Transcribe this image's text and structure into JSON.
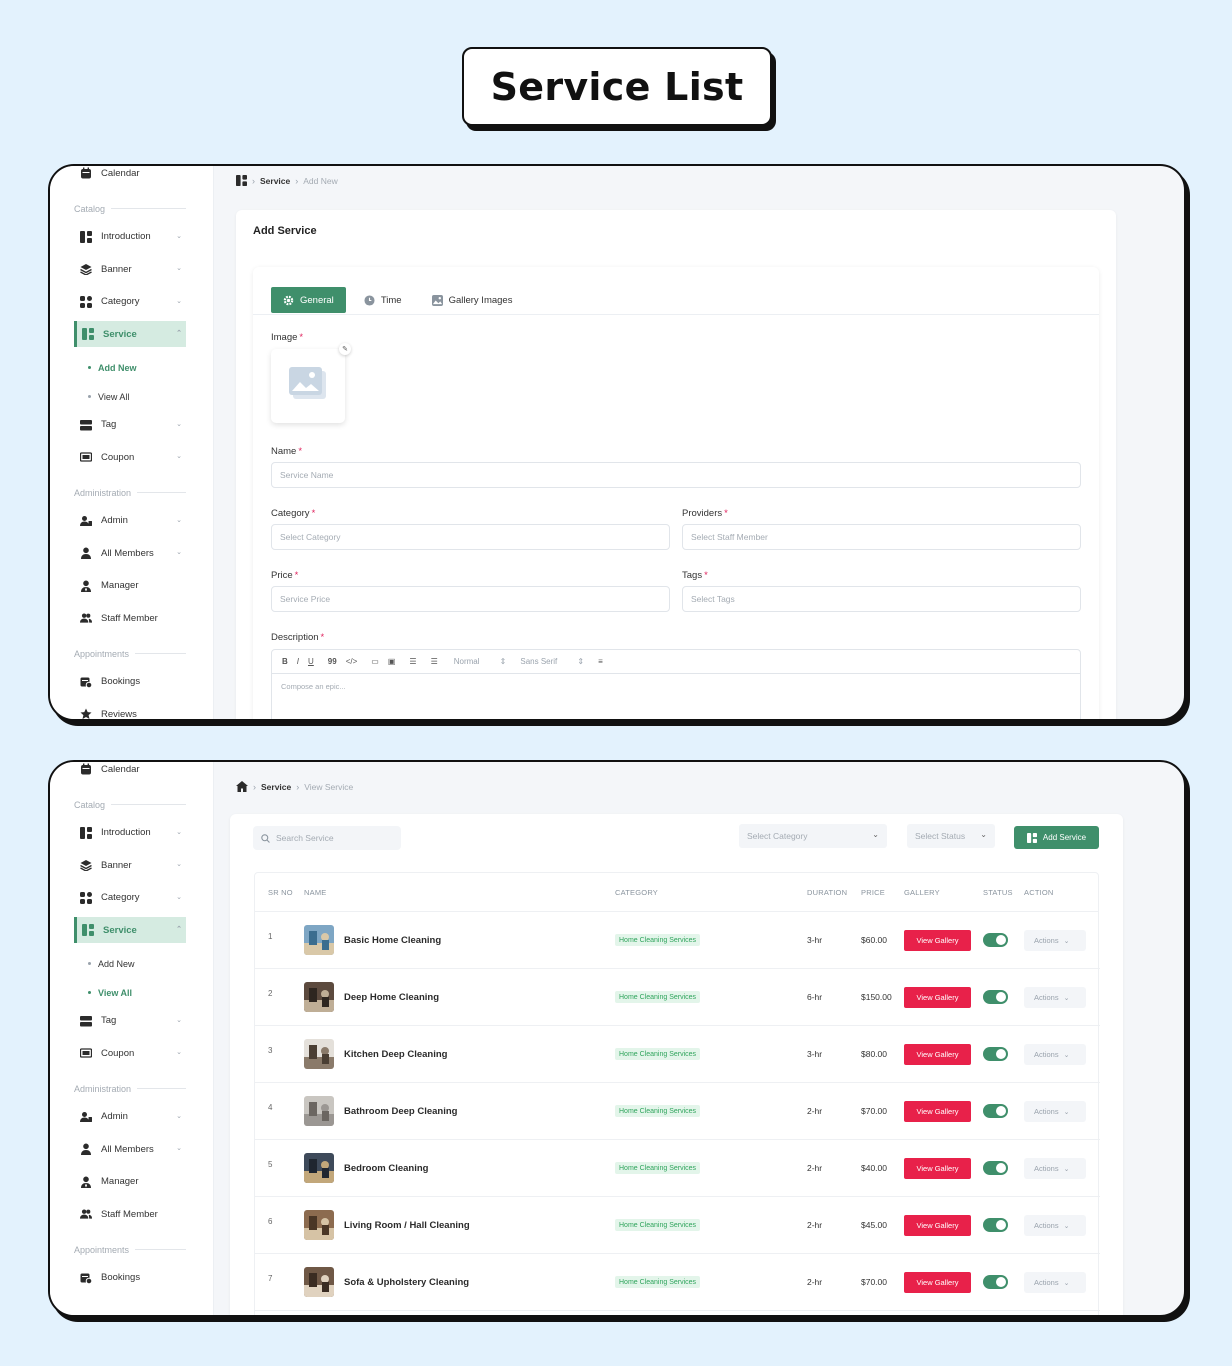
{
  "page_title": "Service List",
  "colors": {
    "accent": "#3f8f6b",
    "danger": "#e8214a",
    "background": "#e3f2fd"
  },
  "sidebar1": {
    "items": [
      {
        "label": "Calendar",
        "icon": "calendar-icon"
      },
      {
        "section": "Catalog"
      },
      {
        "label": "Introduction",
        "icon": "layout-icon",
        "chevron": true
      },
      {
        "label": "Banner",
        "icon": "layers-icon",
        "chevron": true
      },
      {
        "label": "Category",
        "icon": "grid-icon",
        "chevron": true
      },
      {
        "label": "Service",
        "icon": "layout-icon",
        "chevron": true,
        "active": true
      },
      {
        "sub": "Add New",
        "active": true
      },
      {
        "sub": "View All"
      },
      {
        "label": "Tag",
        "icon": "tag-icon",
        "chevron": true
      },
      {
        "label": "Coupon",
        "icon": "coupon-icon",
        "chevron": true
      },
      {
        "section": "Administration"
      },
      {
        "label": "Admin",
        "icon": "admin-icon",
        "chevron": true
      },
      {
        "label": "All Members",
        "icon": "user-icon",
        "chevron": true
      },
      {
        "label": "Manager",
        "icon": "manager-icon"
      },
      {
        "label": "Staff Member",
        "icon": "users-icon"
      },
      {
        "section": "Appointments"
      },
      {
        "label": "Bookings",
        "icon": "bookings-icon"
      },
      {
        "label": "Reviews",
        "icon": "star-icon"
      }
    ]
  },
  "sidebar2": {
    "items": [
      {
        "label": "Calendar",
        "icon": "calendar-icon"
      },
      {
        "section": "Catalog"
      },
      {
        "label": "Introduction",
        "icon": "layout-icon",
        "chevron": true
      },
      {
        "label": "Banner",
        "icon": "layers-icon",
        "chevron": true
      },
      {
        "label": "Category",
        "icon": "grid-icon",
        "chevron": true
      },
      {
        "label": "Service",
        "icon": "layout-icon",
        "chevron": true,
        "active": true
      },
      {
        "sub": "Add New"
      },
      {
        "sub": "View All",
        "active": true
      },
      {
        "label": "Tag",
        "icon": "tag-icon",
        "chevron": true
      },
      {
        "label": "Coupon",
        "icon": "coupon-icon",
        "chevron": true
      },
      {
        "section": "Administration"
      },
      {
        "label": "Admin",
        "icon": "admin-icon",
        "chevron": true
      },
      {
        "label": "All Members",
        "icon": "user-icon",
        "chevron": true
      },
      {
        "label": "Manager",
        "icon": "manager-icon"
      },
      {
        "label": "Staff Member",
        "icon": "users-icon"
      },
      {
        "section": "Appointments"
      },
      {
        "label": "Bookings",
        "icon": "bookings-icon"
      }
    ]
  },
  "add": {
    "breadcrumb": {
      "parent": "Service",
      "current": "Add New"
    },
    "card_title": "Add Service",
    "tabs": [
      "General",
      "Time",
      "Gallery Images"
    ],
    "image_label": "Image",
    "name_label": "Name",
    "name_placeholder": "Service Name",
    "category_label": "Category",
    "category_placeholder": "Select Category",
    "providers_label": "Providers",
    "providers_placeholder": "Select Staff Member",
    "price_label": "Price",
    "price_placeholder": "Service Price",
    "tags_label": "Tags",
    "tags_placeholder": "Select Tags",
    "description_label": "Description",
    "toolbar": {
      "bold": "B",
      "italic": "I",
      "underline": "U",
      "quote": "99",
      "code": "</>",
      "size": "Normal",
      "font": "Sans Serif"
    },
    "editor_placeholder": "Compose an epic..."
  },
  "list": {
    "breadcrumb": {
      "parent": "Service",
      "current": "View Service"
    },
    "search_placeholder": "Search Service",
    "category_filter": "Select Category",
    "status_filter": "Select Status",
    "add_button": "Add Service",
    "columns": [
      "SR NO",
      "NAME",
      "CATEGORY",
      "DURATION",
      "PRICE",
      "GALLERY",
      "STATUS",
      "ACTION"
    ],
    "gallery_button": "View Gallery",
    "actions_label": "Actions",
    "rows": [
      {
        "sr": "1",
        "name": "Basic Home Cleaning",
        "category": "Home Cleaning Services",
        "duration": "3-hr",
        "price": "$60.00",
        "status": true
      },
      {
        "sr": "2",
        "name": "Deep Home Cleaning",
        "category": "Home Cleaning Services",
        "duration": "6-hr",
        "price": "$150.00",
        "status": true
      },
      {
        "sr": "3",
        "name": "Kitchen Deep Cleaning",
        "category": "Home Cleaning Services",
        "duration": "3-hr",
        "price": "$80.00",
        "status": true
      },
      {
        "sr": "4",
        "name": "Bathroom Deep Cleaning",
        "category": "Home Cleaning Services",
        "duration": "2-hr",
        "price": "$70.00",
        "status": true
      },
      {
        "sr": "5",
        "name": "Bedroom Cleaning",
        "category": "Home Cleaning Services",
        "duration": "2-hr",
        "price": "$40.00",
        "status": true
      },
      {
        "sr": "6",
        "name": "Living Room / Hall Cleaning",
        "category": "Home Cleaning Services",
        "duration": "2-hr",
        "price": "$45.00",
        "status": true
      },
      {
        "sr": "7",
        "name": "Sofa & Upholstery Cleaning",
        "category": "Home Cleaning Services",
        "duration": "2-hr",
        "price": "$70.00",
        "status": true
      }
    ]
  }
}
